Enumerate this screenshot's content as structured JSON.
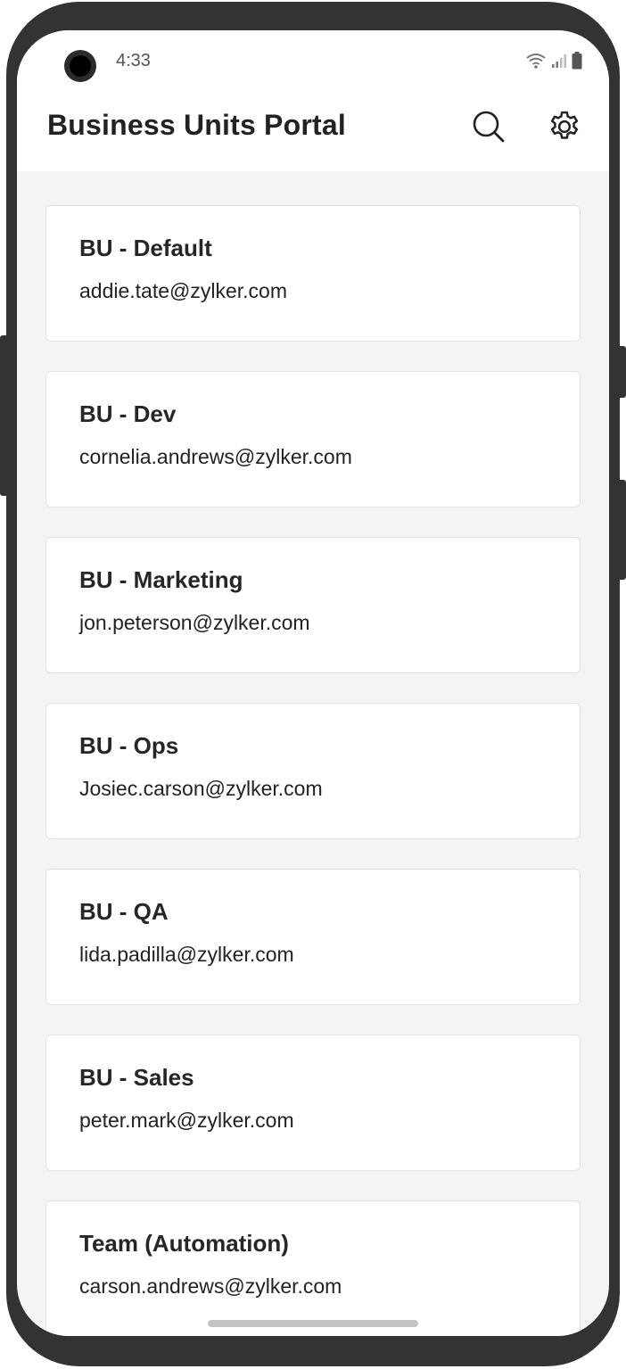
{
  "status_bar": {
    "time": "4:33",
    "icons": [
      "wifi-icon",
      "signal-icon",
      "battery-icon"
    ]
  },
  "header": {
    "title": "Business Units Portal",
    "icons": [
      "search-icon",
      "gear-icon"
    ]
  },
  "business_units": [
    {
      "name": "BU - Default",
      "email": "addie.tate@zylker.com"
    },
    {
      "name": "BU - Dev",
      "email": "cornelia.andrews@zylker.com"
    },
    {
      "name": "BU - Marketing",
      "email": "jon.peterson@zylker.com"
    },
    {
      "name": "BU - Ops",
      "email": "Josiec.carson@zylker.com"
    },
    {
      "name": "BU - QA",
      "email": "lida.padilla@zylker.com"
    },
    {
      "name": "BU - Sales",
      "email": "peter.mark@zylker.com"
    },
    {
      "name": "Team (Automation)",
      "email": "carson.andrews@zylker.com"
    }
  ],
  "colors": {
    "frame": "#333333",
    "background": "#f4f4f4",
    "card": "#ffffff",
    "text": "#222222"
  }
}
